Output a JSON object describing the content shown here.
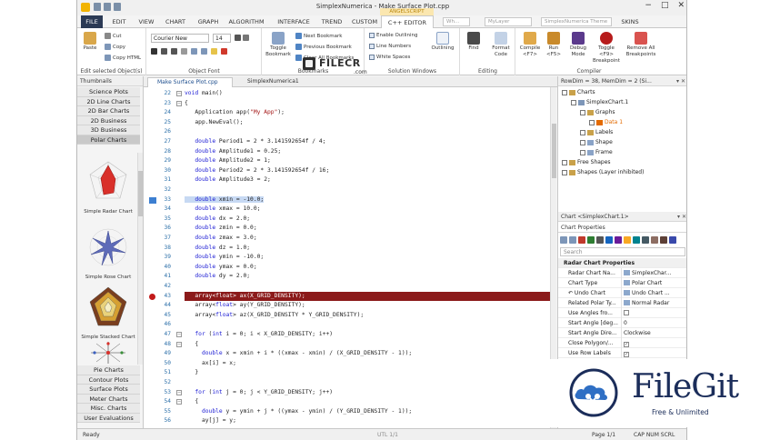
{
  "window": {
    "title": "SimplexNumerica - Make Surface Plot.cpp",
    "controls": [
      "−",
      "□",
      "✕"
    ]
  },
  "menu": {
    "tabs": [
      "FILE",
      "EDIT",
      "VIEW",
      "CHART",
      "GRAPH",
      "ALGORITHM",
      "INTERFACE",
      "TREND",
      "CUSTOM",
      "C++ EDITOR"
    ],
    "context_label": "ANGELSCRIPT",
    "search1": "Wh...",
    "search2": "MyLayer",
    "theme": "SimplexNumerica Theme",
    "skins": "SKINS"
  },
  "ribbon": {
    "clipboard": {
      "paste": "Paste",
      "cut": "Cut",
      "copy": "Copy",
      "copy_html": "Copy HTML",
      "label": "Edit selected Object(s)"
    },
    "font": {
      "family": "Courier New",
      "size": "14",
      "label": "Object Font"
    },
    "bookmarks": {
      "toggle": "Toggle Bookmark",
      "next": "Next Bookmark",
      "prev": "Previous Bookmark",
      "clear": "Clear All Bookmarks",
      "label": "Bookmarks"
    },
    "solution": {
      "enable_outlining": "Enable Outlining",
      "line_numbers": "Line Numbers",
      "white_spaces": "White Spaces",
      "outlining": "Outlining",
      "label": "Solution Windows"
    },
    "editing": {
      "find": "Find",
      "format": "Format Code",
      "label": "Editing"
    },
    "compile": {
      "compile": "Compile <F7>",
      "run": "Run <F5>",
      "debug": "Debug Mode",
      "toggle_bp": "Toggle <F9> Breakpoint",
      "remove_bp": "Remove All Breakpoints",
      "label": "Compiler"
    }
  },
  "thumbnails": {
    "header": "Thumbnails",
    "categories_top": [
      "Science Plots",
      "2D Line Charts",
      "2D Bar Charts",
      "2D Business",
      "3D Business",
      "Polar Charts"
    ],
    "selected": "Polar Charts",
    "items": [
      "Simple Radar Chart",
      "Simple Rose Chart",
      "Simple Stacked Chart"
    ],
    "categories_bottom": [
      "Pie Charts",
      "Contour Plots",
      "Surface Plots",
      "Meter Charts",
      "Misc. Charts",
      "User Evaluations"
    ]
  },
  "editor": {
    "tabs": [
      "Make Surface Plot.cpp",
      "SimplexNumerica1"
    ],
    "lines": [
      {
        "n": "22",
        "text": "void main()"
      },
      {
        "n": "23",
        "text": "{"
      },
      {
        "n": "24",
        "text": "   Application app(\"My App\");"
      },
      {
        "n": "25",
        "text": "   app.NewEval();"
      },
      {
        "n": "26",
        "text": ""
      },
      {
        "n": "27",
        "text": "   double Period1 = 2 * 3.141592654f / 4;"
      },
      {
        "n": "28",
        "text": "   double Amplitude1 = 0.25;"
      },
      {
        "n": "29",
        "text": "   double Amplitude2 = 1;"
      },
      {
        "n": "30",
        "text": "   double Period2 = 2 * 3.141592654f / 16;"
      },
      {
        "n": "31",
        "text": "   double Amplitude3 = 2;"
      },
      {
        "n": "32",
        "text": ""
      },
      {
        "n": "33",
        "text": "   double xmin = -10.0;"
      },
      {
        "n": "34",
        "text": "   double xmax = 10.0;"
      },
      {
        "n": "35",
        "text": "   double dx = 2.0;"
      },
      {
        "n": "36",
        "text": "   double zmin = 0.0;"
      },
      {
        "n": "37",
        "text": "   double zmax = 3.0;"
      },
      {
        "n": "38",
        "text": "   double dz = 1.0;"
      },
      {
        "n": "39",
        "text": "   double ymin = -10.0;"
      },
      {
        "n": "40",
        "text": "   double ymax = 0.0;"
      },
      {
        "n": "41",
        "text": "   double dy = 2.0;"
      },
      {
        "n": "42",
        "text": ""
      },
      {
        "n": "43",
        "text": "   array<float> ax(X_GRID_DENSITY);"
      },
      {
        "n": "44",
        "text": "   array<float> ay(Y_GRID_DENSITY);"
      },
      {
        "n": "45",
        "text": "   array<float> az(X_GRID_DENSITY * Y_GRID_DENSITY);"
      },
      {
        "n": "46",
        "text": ""
      },
      {
        "n": "47",
        "text": "   for (int i = 0; i < X_GRID_DENSITY; i++)"
      },
      {
        "n": "48",
        "text": "   {"
      },
      {
        "n": "49",
        "text": "     double x = xmin + i * ((xmax - xmin) / (X_GRID_DENSITY - 1));"
      },
      {
        "n": "50",
        "text": "     ax[i] = x;"
      },
      {
        "n": "51",
        "text": "   }"
      },
      {
        "n": "52",
        "text": ""
      },
      {
        "n": "53",
        "text": "   for (int j = 0; j < Y_GRID_DENSITY; j++)"
      },
      {
        "n": "54",
        "text": "   {"
      },
      {
        "n": "55",
        "text": "     double y = ymin + j * ((ymax - ymin) / (Y_GRID_DENSITY - 1));"
      },
      {
        "n": "56",
        "text": "     ay[j] = y;"
      }
    ]
  },
  "tree": {
    "header": "RowDim = 38, MemDim = 2 (Si...",
    "nodes": [
      "Charts",
      "SimplexChart.1",
      "Graphs",
      "Data 1",
      "Labels",
      "Shape",
      "Frame",
      "Free Shapes",
      "Shapes (Layer inhibited)"
    ]
  },
  "properties": {
    "header_top": "Chart <SimplexChart.1>",
    "header": "Chart Properties",
    "search": "Search",
    "section": "Radar Chart Properties",
    "rows": [
      {
        "name": "Radar Chart Na...",
        "value": "SimplexChar..."
      },
      {
        "name": "Chart Type",
        "value": "Polar Chart"
      },
      {
        "name": "↶ Undo Chart",
        "value": "Undo Chart ..."
      },
      {
        "name": "Related Polar Ty...",
        "value": "Normal Radar"
      },
      {
        "name": "Use Angles fro...",
        "value": ""
      },
      {
        "name": "Start Angle [deg...",
        "value": "0"
      },
      {
        "name": "Start Angle Dire...",
        "value": "Clockwise"
      },
      {
        "name": "Close Polygon/...",
        "value": "✓"
      },
      {
        "name": "Use Row Labels",
        "value": "✓"
      }
    ]
  },
  "status": {
    "ready": "Ready",
    "mid": "UTL 1/1",
    "page": "Page 1/1",
    "caps": "CAP NUM SCRL"
  },
  "watermarks": {
    "filecr": "FILECR",
    "filecr_sub": ".com",
    "filegit_name": "FileGit",
    "filegit_tag": "Free & Unlimited"
  }
}
